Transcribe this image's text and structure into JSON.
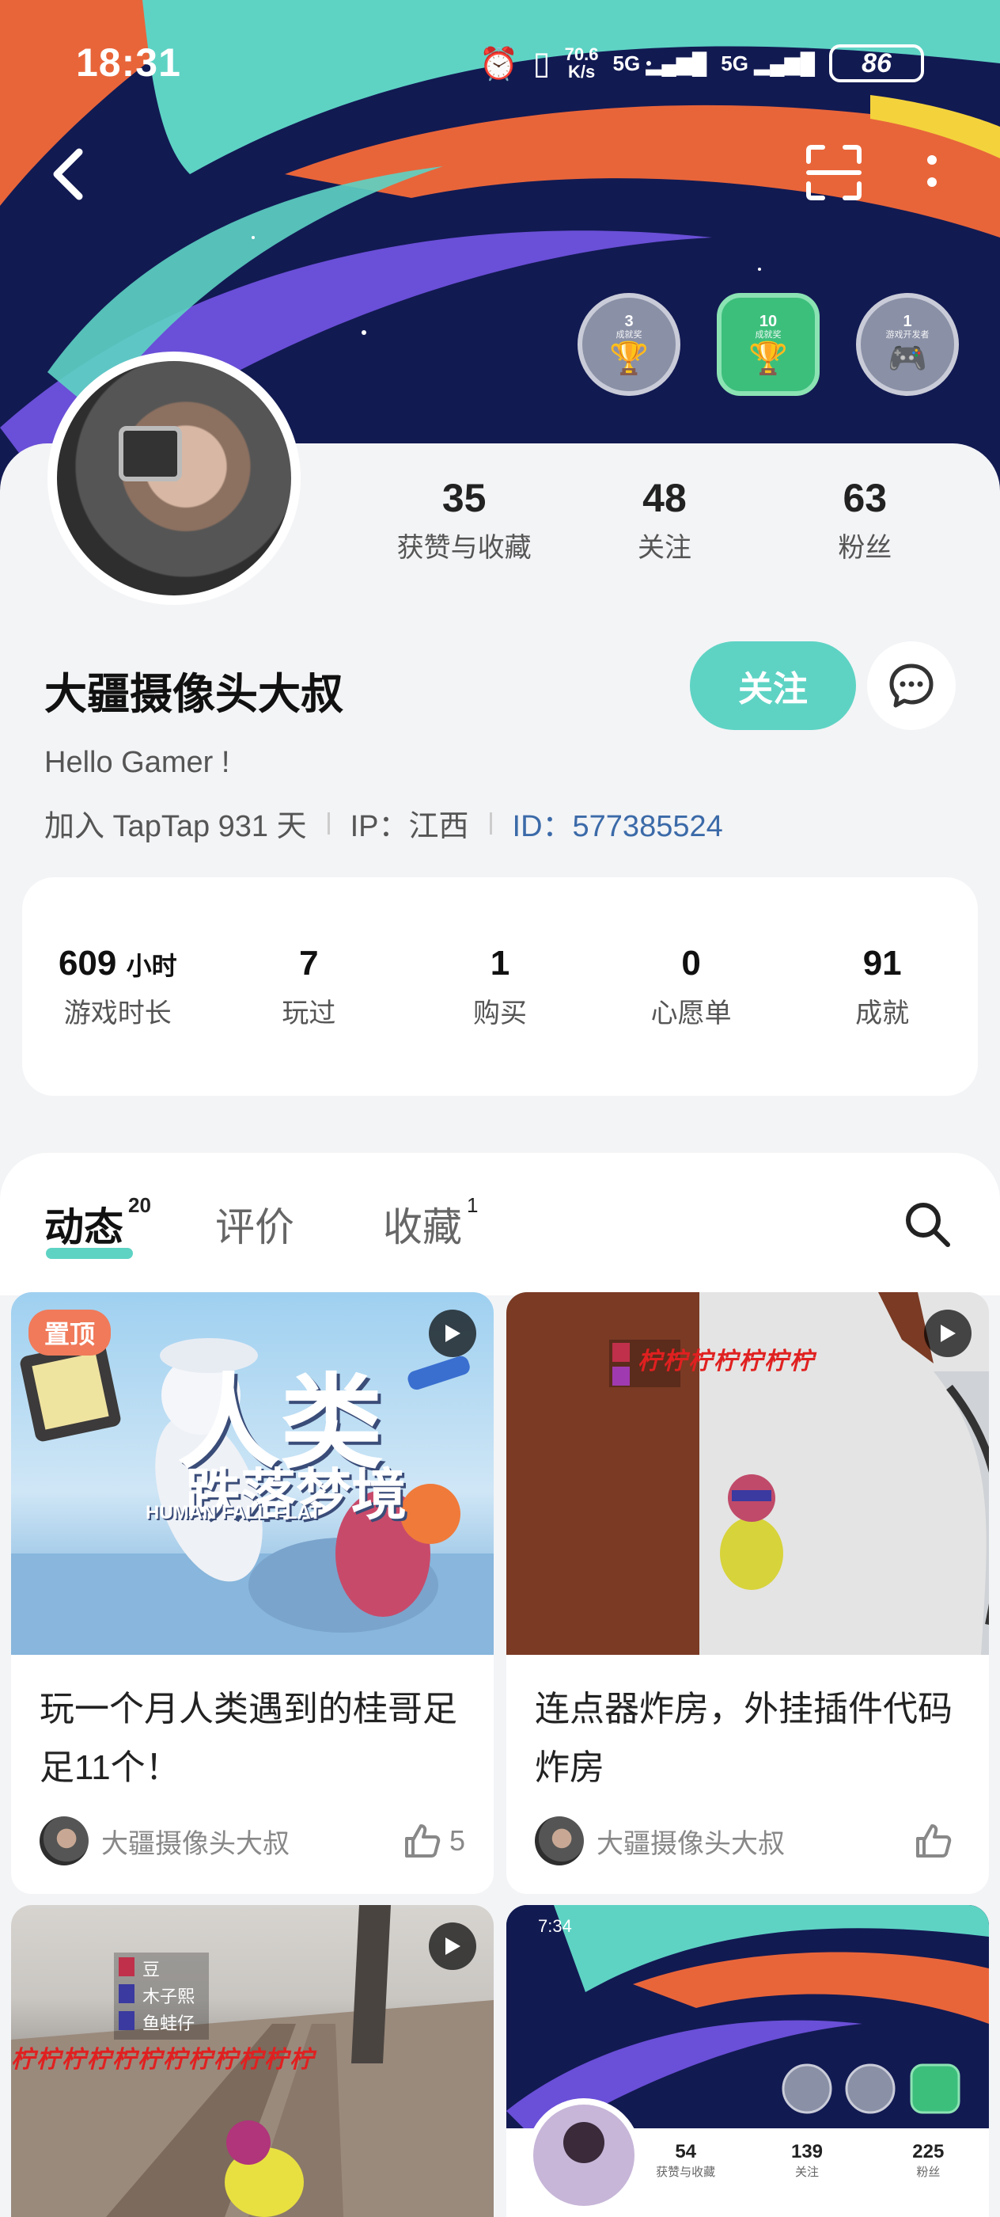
{
  "status": {
    "time": "18:31",
    "speed_value": "70.6",
    "speed_unit": "K/s",
    "net1": "5G",
    "net2": "5G",
    "battery": "86"
  },
  "badges": [
    {
      "num": "3",
      "tiny": "成就奖"
    },
    {
      "num": "10",
      "tiny": "成就奖"
    },
    {
      "num": "1",
      "tiny": "游戏开发者"
    }
  ],
  "stats_top": [
    {
      "value": "35",
      "label": "获赞与收藏"
    },
    {
      "value": "48",
      "label": "关注"
    },
    {
      "value": "63",
      "label": "粉丝"
    }
  ],
  "profile": {
    "name": "大疆摄像头大叔",
    "follow_label": "关注",
    "bio": "Hello Gamer !",
    "joined": "加入 TapTap 931 天",
    "ip": "IP：江西",
    "uid": "ID：577385524"
  },
  "game_stats": [
    {
      "value": "609",
      "unit": "小时",
      "label": "游戏时长"
    },
    {
      "value": "7",
      "unit": "",
      "label": "玩过"
    },
    {
      "value": "1",
      "unit": "",
      "label": "购买"
    },
    {
      "value": "0",
      "unit": "",
      "label": "心愿单"
    },
    {
      "value": "91",
      "unit": "",
      "label": "成就"
    }
  ],
  "tabs": [
    {
      "label": "动态",
      "count": "20"
    },
    {
      "label": "评价",
      "count": ""
    },
    {
      "label": "收藏",
      "count": "1"
    }
  ],
  "posts": [
    {
      "pin": "置顶",
      "cover_big": "人类",
      "cover_sub": "跌落梦境",
      "cover_en": "HUMAN FALL FLAT",
      "title": "玩一个月人类遇到的桂哥足足11个！",
      "author": "大疆摄像头大叔",
      "likes": "5"
    },
    {
      "title": "连点器炸房，外挂插件代码炸房",
      "author": "大疆摄像头大叔",
      "likes": "",
      "red_text": "柠柠柠柠柠柠柠"
    },
    {
      "players": [
        "豆",
        "木子熙",
        "鱼蛙仔"
      ],
      "red_text": "柠柠柠柠柠柠柠柠柠柠柠柠"
    },
    {
      "inner_time": "7:34",
      "inner_stats": [
        {
          "value": "54",
          "label": "获赞与收藏"
        },
        {
          "value": "139",
          "label": "关注"
        },
        {
          "value": "225",
          "label": "粉丝"
        }
      ]
    }
  ]
}
